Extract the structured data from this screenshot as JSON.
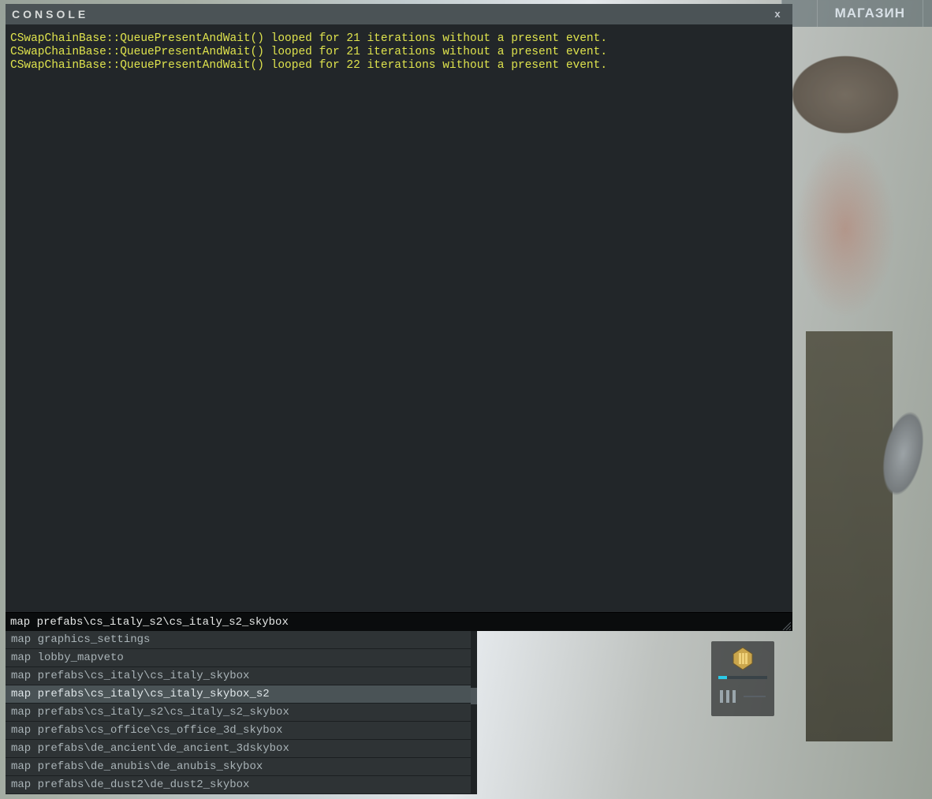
{
  "topnav": {
    "shop_label": "МАГАЗИН"
  },
  "console": {
    "title": "CONSOLE",
    "close_label": "x",
    "log_lines": [
      "CSwapChainBase::QueuePresentAndWait() looped for 21 iterations without a present event.",
      "CSwapChainBase::QueuePresentAndWait() looped for 21 iterations without a present event.",
      "CSwapChainBase::QueuePresentAndWait() looped for 22 iterations without a present event."
    ],
    "input_value": "map prefabs\\cs_italy_s2\\cs_italy_s2_skybox"
  },
  "autocomplete": {
    "selected_index": 3,
    "scroll_thumb": {
      "top_pct": 35,
      "height_pct": 10
    },
    "items": [
      "map graphics_settings",
      "map lobby_mapveto",
      "map prefabs\\cs_italy\\cs_italy_skybox",
      "map prefabs\\cs_italy\\cs_italy_skybox_s2",
      "map prefabs\\cs_italy_s2\\cs_italy_s2_skybox",
      "map prefabs\\cs_office\\cs_office_3d_skybox",
      "map prefabs\\de_ancient\\de_ancient_3dskybox",
      "map prefabs\\de_anubis\\de_anubis_skybox",
      "map prefabs\\de_dust2\\de_dust2_skybox"
    ]
  },
  "colors": {
    "log_text": "#dfe34d",
    "console_bg": "#222629",
    "topnav_text": "#d8e0e6"
  }
}
